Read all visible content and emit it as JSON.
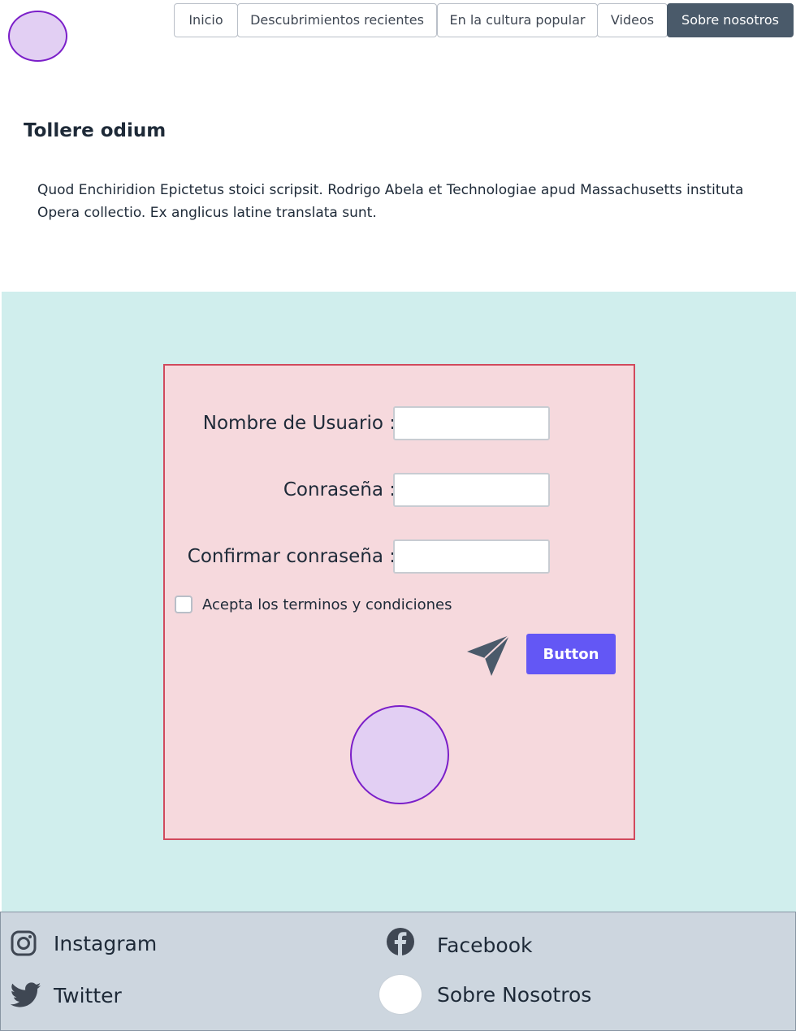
{
  "nav": {
    "tabs": [
      {
        "label": "Inicio"
      },
      {
        "label": "Descubrimientos recientes"
      },
      {
        "label": "En la cultura popular"
      },
      {
        "label": "Videos"
      },
      {
        "label": "Sobre nosotros"
      }
    ],
    "active_index": 4
  },
  "main": {
    "title": "Tollere odium",
    "description": "Quod Enchiridion Epictetus stoici scripsit. Rodrigo Abela et Technologiae apud Massachusetts instituta Opera collectio. Ex anglicus latine translata sunt."
  },
  "form": {
    "username_label": "Nombre de Usuario :",
    "password_label": "Conraseña :",
    "confirm_label": "Confirmar conraseña :",
    "username_value": "",
    "password_value": "",
    "confirm_value": "",
    "terms_label": "Acepta los terminos y condiciones",
    "terms_checked": false,
    "button_label": "Button",
    "send_icon": "send-icon"
  },
  "footer": {
    "instagram_label": "Instagram",
    "facebook_label": "Facebook",
    "twitter_label": "Twitter",
    "about_label": "Sobre Nosotros"
  },
  "colors": {
    "accent": "#6357f5",
    "nav_active": "#4a5a6a",
    "section_bg": "#d0eeed",
    "form_bg": "#f6d9dd",
    "form_border": "#d04a5d",
    "circle_fill": "#e2cff3",
    "circle_border": "#7b1fc9",
    "footer_bg": "#cdd6df"
  }
}
